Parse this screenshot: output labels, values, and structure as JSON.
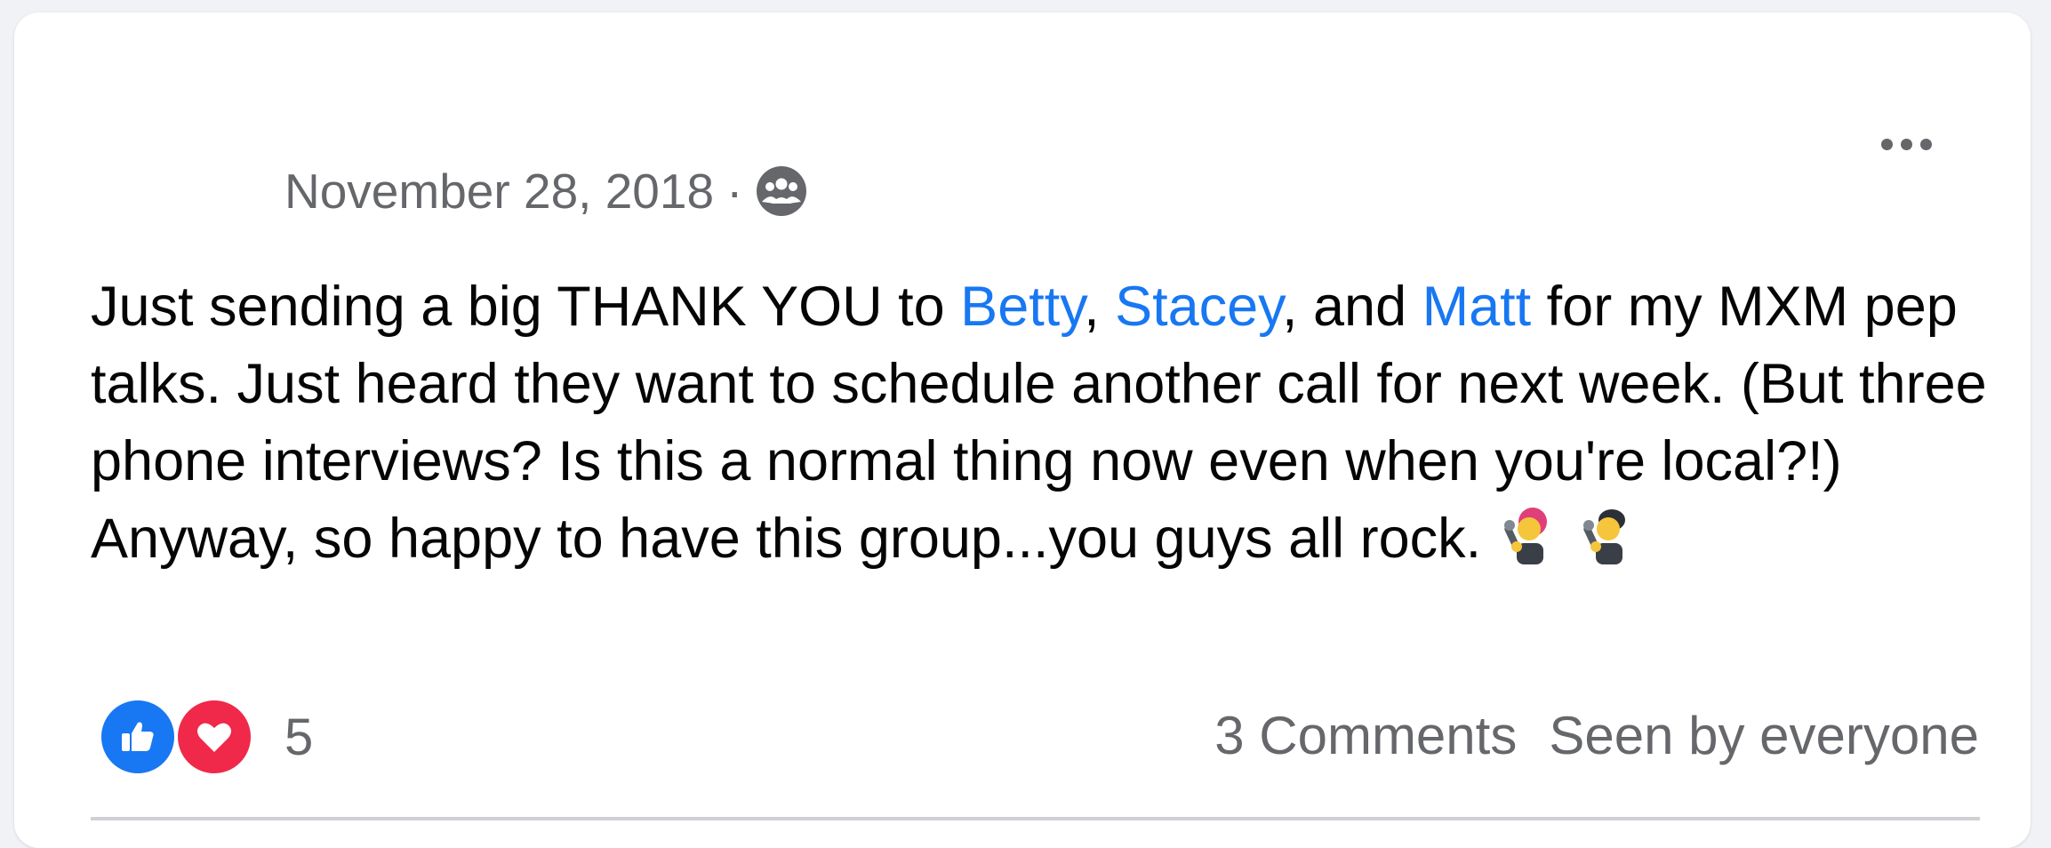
{
  "post": {
    "date": "November 28, 2018",
    "separator": "·",
    "audience_icon": "group-audience-icon",
    "more_icon": "more-horizontal-icon",
    "text_parts": {
      "p1": "Just sending a big THANK YOU to ",
      "mention1": "Betty",
      "p2": ", ",
      "mention2": "Stacey",
      "p3": ", and ",
      "mention3": "Matt",
      "p4": " for my MXM pep talks. Just heard they want to schedule another call for next week. (But three phone interviews? Is this a normal thing now even when you're local?!) Anyway, so happy to have this group...you guys all rock. ",
      "emoji1": "woman-singer-emoji",
      "emoji2": "man-singer-emoji"
    },
    "reactions": {
      "icons": [
        "like-icon",
        "love-icon"
      ],
      "count": "5"
    },
    "comments": "3 Comments",
    "seen_by": "Seen by everyone"
  },
  "colors": {
    "mention": "#1877f2",
    "secondary_text": "#65676b",
    "like": "#1877f2",
    "love": "#f02849"
  }
}
